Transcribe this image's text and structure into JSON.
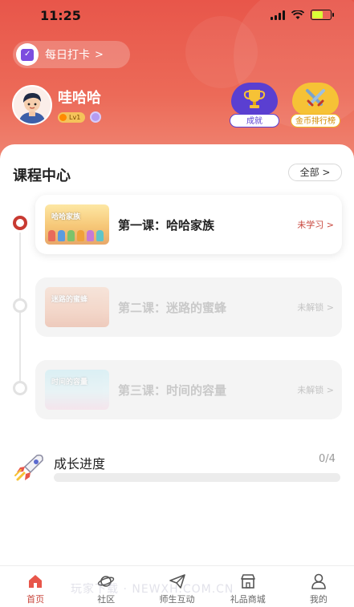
{
  "status_bar": {
    "time": "11:25"
  },
  "header": {
    "checkin_label": "每日打卡",
    "checkin_arrow": ">",
    "username": "哇哈哈",
    "level_badge": "Lv1",
    "achievement_label": "成就",
    "rank_label": "金币排行榜"
  },
  "courses_section": {
    "title": "课程中心",
    "all_button": "全部 >",
    "items": [
      {
        "thumb_title": "哈哈家族",
        "title": "第一课：哈哈家族",
        "status": "未学习 >",
        "locked": false
      },
      {
        "thumb_title": "迷路的蜜蜂",
        "title": "第二课：迷路的蜜蜂",
        "status": "未解锁 >",
        "locked": true
      },
      {
        "thumb_title": "时间的容量",
        "title": "第三课：时间的容量",
        "status": "未解锁 >",
        "locked": true
      }
    ]
  },
  "growth": {
    "title": "成长进度",
    "count": "0/4",
    "progress_fraction": 0
  },
  "tabbar": {
    "items": [
      {
        "label": "首页",
        "icon": "home-icon",
        "active": true
      },
      {
        "label": "社区",
        "icon": "planet-icon",
        "active": false
      },
      {
        "label": "师生互动",
        "icon": "paper-plane-icon",
        "active": false
      },
      {
        "label": "礼品商城",
        "icon": "store-icon",
        "active": false
      },
      {
        "label": "我的",
        "icon": "user-icon",
        "active": false
      }
    ]
  },
  "watermark": "玩家下载 · NEWXH.COM.CN",
  "colors": {
    "header_red": "#e8564a",
    "accent_red": "#c8463c",
    "achievement_purple": "#5a3fd1",
    "rank_gold": "#f6c236"
  }
}
